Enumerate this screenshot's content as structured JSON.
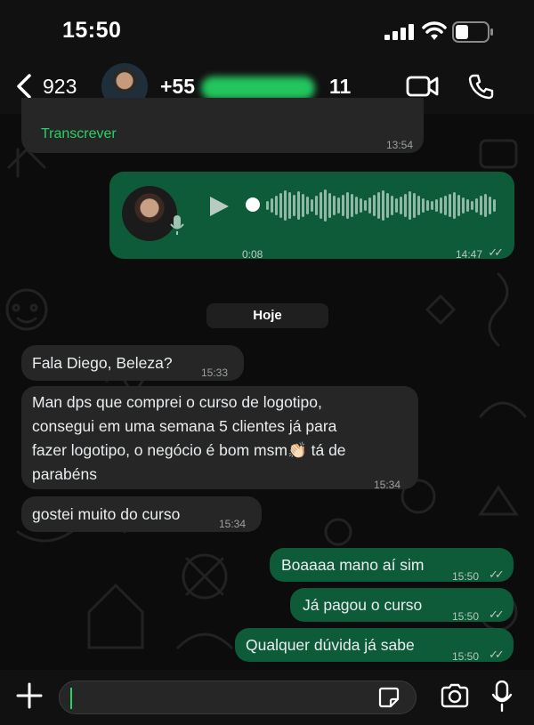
{
  "status": {
    "time": "15:50"
  },
  "header": {
    "back_count": "923",
    "contact_prefix": "+55",
    "contact_suffix": "11"
  },
  "messages": {
    "transcribe_label": "Transcrever",
    "transcribe_time": "13:54",
    "voice_duration": "0:08",
    "voice_time": "14:47",
    "date_chip": "Hoje",
    "in1": {
      "text": "Fala Diego, Beleza?",
      "time": "15:33"
    },
    "in2": {
      "line1": "Man dps que comprei o curso de logotipo,",
      "line2": "consegui em uma semana 5 clientes já para",
      "line3": "fazer logotipo, o negócio é bom msm👏🏻 tá de",
      "line4": "parabéns",
      "time": "15:34"
    },
    "in3": {
      "text": "gostei muito do curso",
      "time": "15:34"
    },
    "out1": {
      "text": "Boaaaa mano aí sim",
      "time": "15:50"
    },
    "out2": {
      "text": "Já pagou o curso",
      "time": "15:50"
    },
    "out3": {
      "text": "Qualquer dúvida já sabe",
      "time": "15:50"
    }
  },
  "colors": {
    "outgoing": "#0d5b39",
    "incoming": "#262626",
    "accent": "#25d366"
  }
}
